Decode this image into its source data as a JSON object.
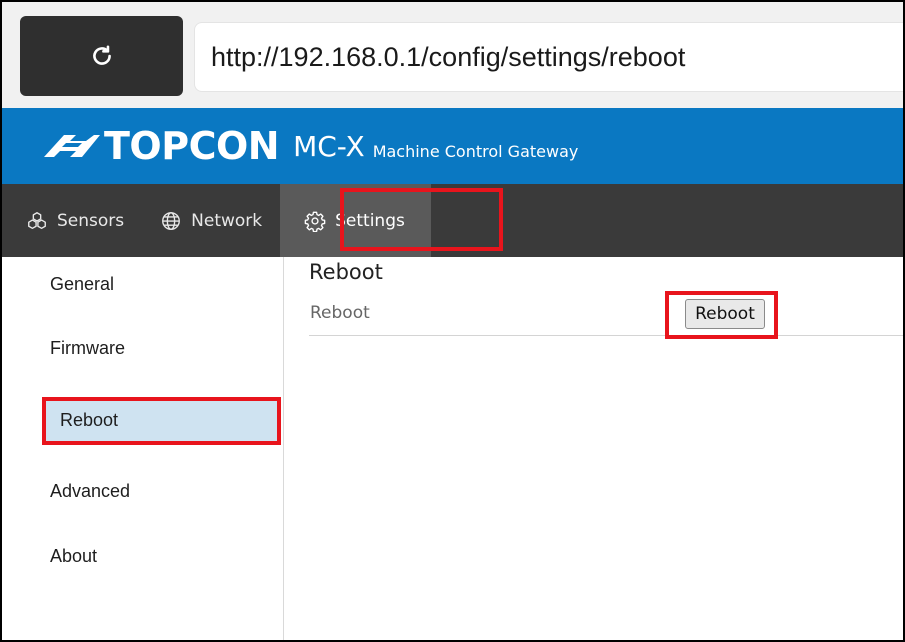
{
  "browser": {
    "url": "http://192.168.0.1/config/settings/reboot"
  },
  "header": {
    "brand": "TOPCON",
    "product": "MC-X",
    "subtitle": "Machine Control Gateway",
    "color": "#0a78c2"
  },
  "nav": {
    "items": [
      {
        "label": "Sensors",
        "icon": "sensors-icon"
      },
      {
        "label": "Network",
        "icon": "globe-icon"
      },
      {
        "label": "Settings",
        "icon": "gear-icon",
        "active": true
      }
    ]
  },
  "sidebar": {
    "items": [
      {
        "label": "General"
      },
      {
        "label": "Firmware"
      },
      {
        "label": "Reboot",
        "active": true
      },
      {
        "label": "Advanced"
      },
      {
        "label": "About"
      }
    ]
  },
  "content": {
    "title": "Reboot",
    "row_label": "Reboot",
    "button_label": "Reboot"
  },
  "highlight_color": "#e8141c"
}
